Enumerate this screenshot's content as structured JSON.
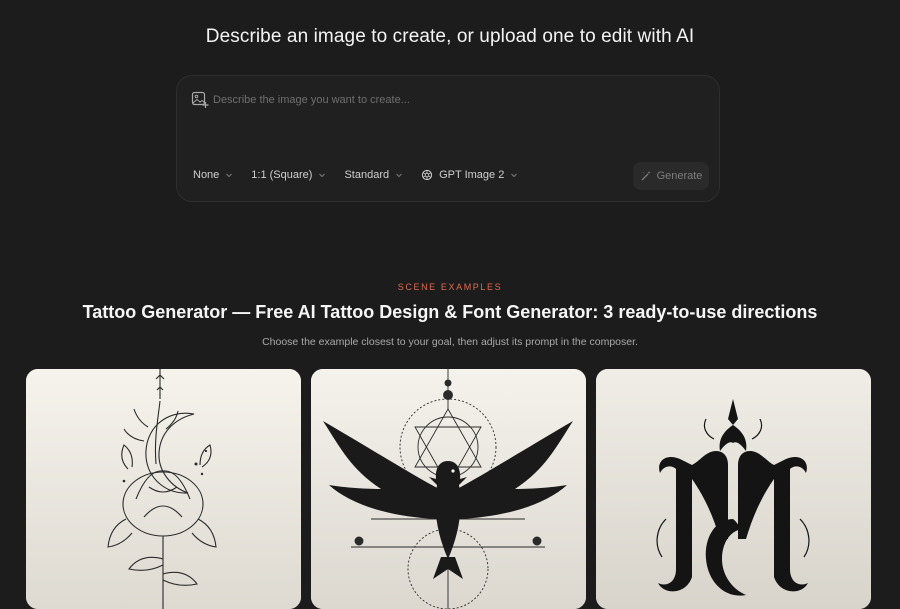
{
  "header": {
    "headline": "Describe an image to create, or upload one to edit with AI"
  },
  "composer": {
    "prompt_placeholder": "Describe the image you want to create...",
    "prompt_value": "",
    "style_option": "None",
    "aspect_option": "1:1 (Square)",
    "quality_option": "Standard",
    "model_option": "GPT Image 2",
    "generate_label": "Generate",
    "icons": [
      "image-upload-icon",
      "chevron-down-icon",
      "model-icon",
      "wand-icon"
    ]
  },
  "examples": {
    "eyebrow": "SCENE EXAMPLES",
    "title": "Tattoo Generator — Free AI Tattoo Design & Font Generator: 3 ready-to-use directions",
    "subtitle": "Choose the example closest to your goal, then adjust its prompt in the composer.",
    "cards": [
      {
        "name": "floral-moon-tattoo"
      },
      {
        "name": "raven-sacred-geometry-tattoo"
      },
      {
        "name": "gothic-monogram-tattoo"
      }
    ]
  },
  "colors": {
    "background": "#1c1c1c",
    "panel": "#202020",
    "accent": "#e0694f",
    "text": "#f4f4f4",
    "muted": "#a9a9a9"
  }
}
